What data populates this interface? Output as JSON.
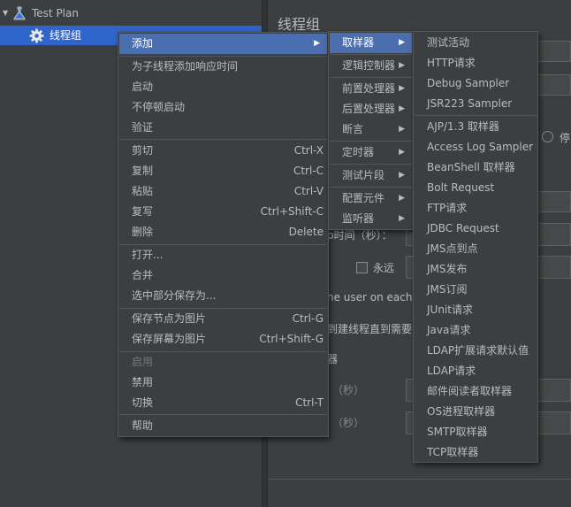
{
  "tree": {
    "root_label": "Test Plan",
    "child_label": "线程组"
  },
  "right": {
    "title": "线程组",
    "label_stop": "停",
    "label_duration": "p时间（秒）：",
    "label_forever": "永远",
    "label_same_user": "he user on each i",
    "label_delay_thread": "到建线程直到需要",
    "label_scheduler": "器",
    "label_duration2": "（秒）",
    "label_delay2": "（秒）"
  },
  "context_menu": {
    "items": [
      {
        "label": "添加",
        "submenu": true
      },
      {
        "label": "为子线程添加响应时间"
      },
      {
        "label": "启动"
      },
      {
        "label": "不停顿启动"
      },
      {
        "label": "验证"
      },
      {
        "label": "剪切",
        "shortcut": "Ctrl-X"
      },
      {
        "label": "复制",
        "shortcut": "Ctrl-C"
      },
      {
        "label": "粘贴",
        "shortcut": "Ctrl-V"
      },
      {
        "label": "复写",
        "shortcut": "Ctrl+Shift-C"
      },
      {
        "label": "删除",
        "shortcut": "Delete"
      },
      {
        "label": "打开..."
      },
      {
        "label": "合并"
      },
      {
        "label": "选中部分保存为..."
      },
      {
        "label": "保存节点为图片",
        "shortcut": "Ctrl-G"
      },
      {
        "label": "保存屏幕为图片",
        "shortcut": "Ctrl+Shift-G"
      },
      {
        "label": "启用"
      },
      {
        "label": "禁用"
      },
      {
        "label": "切换",
        "shortcut": "Ctrl-T"
      },
      {
        "label": "帮助"
      }
    ]
  },
  "add_submenu": {
    "items": [
      {
        "label": "取样器"
      },
      {
        "label": "逻辑控制器"
      },
      {
        "label": "前置处理器"
      },
      {
        "label": "后置处理器"
      },
      {
        "label": "断言"
      },
      {
        "label": "定时器"
      },
      {
        "label": "测试片段"
      },
      {
        "label": "配置元件"
      },
      {
        "label": "监听器"
      }
    ]
  },
  "sampler_submenu": {
    "items": [
      "测试活动",
      "HTTP请求",
      "Debug Sampler",
      "JSR223 Sampler",
      "AJP/1.3 取样器",
      "Access Log Sampler",
      "BeanShell 取样器",
      "Bolt Request",
      "FTP请求",
      "JDBC Request",
      "JMS点到点",
      "JMS发布",
      "JMS订阅",
      "JUnit请求",
      "Java请求",
      "LDAP扩展请求默认值",
      "LDAP请求",
      "邮件阅读者取样器",
      "OS进程取样器",
      "SMTP取样器",
      "TCP取样器"
    ]
  }
}
